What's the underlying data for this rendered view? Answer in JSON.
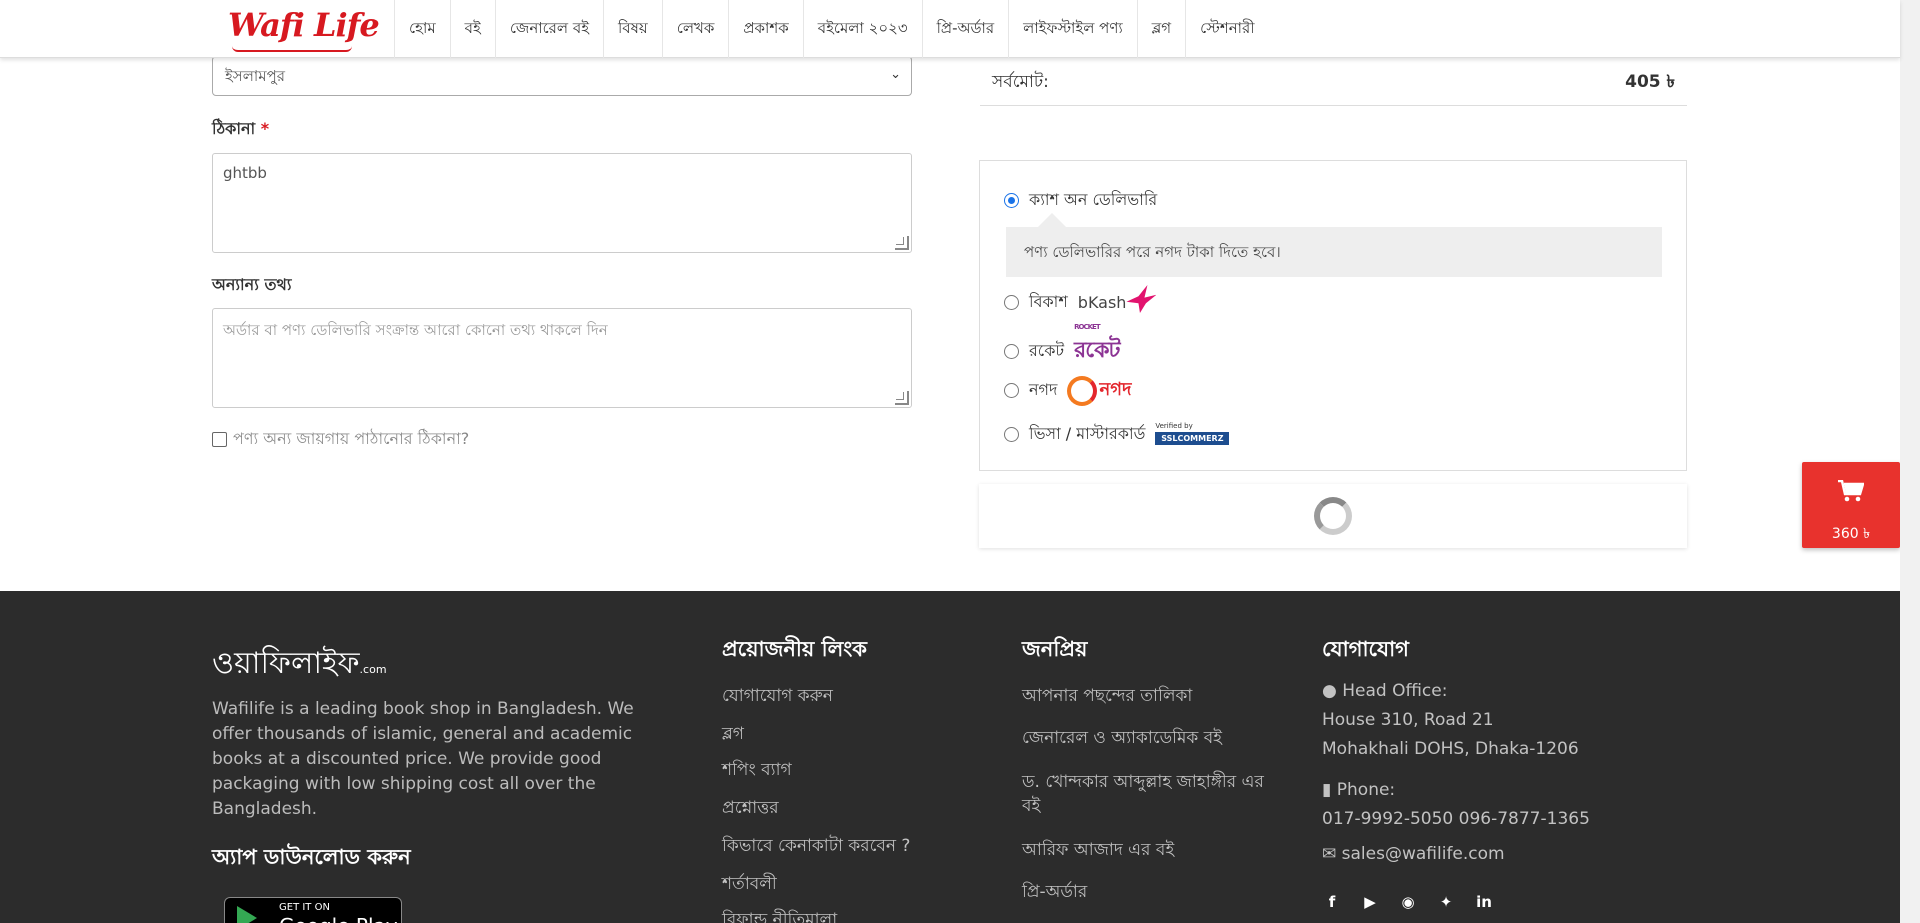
{
  "header": {
    "logo": "Wafi Life",
    "nav": [
      "হোম",
      "বই",
      "জেনারেল বই",
      "বিষয়",
      "লেখক",
      "প্রকাশক",
      "বইমেলা ২০২৩",
      "প্রি-অর্ডার",
      "লাইফস্টাইল পণ্য",
      "ব্লগ",
      "স্টেশনারী"
    ]
  },
  "form": {
    "area_select_value": "ইসলামপুর",
    "address_label": "ঠিকানা",
    "address_required": "*",
    "address_value": "ghtbb",
    "other_info_label": "অন্যান্য তথ্য",
    "other_info_placeholder": "অর্ডার বা পণ্য ডেলিভারি সংক্রান্ত আরো কোনো তথ্য থাকলে দিন",
    "ship_elsewhere_label": "পণ্য অন্য জায়গায় পাঠানোর ঠিকানা?"
  },
  "summary": {
    "total_label": "সর্বমোট:",
    "total_value": "405 ৳"
  },
  "payment": {
    "cod_label": "ক্যাশ অন ডেলিভারি",
    "cod_note": "পণ্য ডেলিভারির পরে নগদ টাকা দিতে হবে।",
    "bkash_label": "বিকাশ",
    "bkash_logo": "bKash",
    "rocket_label": "রকেট",
    "rocket_logo_small": "ROCKET",
    "rocket_logo": "রকেট",
    "nagad_label": "নগদ",
    "nagad_logo": "নগদ",
    "card_label": "ভিসা / মাস্টারকার্ড",
    "ssl_small": "Verified by",
    "ssl_logo": "SSLCOMMERZ",
    "selected": "cod"
  },
  "cart": {
    "total": "360 ৳"
  },
  "footer": {
    "logo": "ওয়াফিলাইফ",
    "logo_suffix": ".com",
    "about": "Wafilife is a leading book shop in Bangladesh. We offer thousands of islamic, general and academic books at a discounted price. We provide good packaging with low shipping cost all over the Bangladesh.",
    "app_heading": "অ্যাপ ডাউনলোড করুন",
    "gplay_small": "GET IT ON",
    "gplay_big": "Google Play",
    "links_heading": "প্রয়োজনীয় লিংক",
    "links": [
      "যোগাযোগ করুন",
      "ব্লগ",
      "শপিং ব্যাগ",
      "প্রশ্নোত্তর",
      "কিভাবে কেনাকাটা করবেন ?",
      "শর্তাবলী",
      "রিফান্ড নীতিমালা"
    ],
    "popular_heading": "জনপ্রিয়",
    "popular": [
      "আপনার পছন্দের তালিকা",
      "জেনারেল ও অ্যাকাডেমিক বই",
      "ড. খোন্দকার আব্দুল্লাহ জাহাঙ্গীর এর",
      "বই",
      "আরিফ আজাদ এর বই",
      "প্রি-অর্ডার"
    ],
    "contact_heading": "যোগাযোগ",
    "office_label": "Head Office:",
    "address_line1": "House 310, Road 21",
    "address_line2": "Mohakhali DOHS, Dhaka-1206",
    "phone_label": "Phone:",
    "phones": "017-9992-5050  096-7877-1365",
    "email": "sales@wafilife.com",
    "social_icons": [
      "facebook-icon",
      "youtube-icon",
      "instagram-icon",
      "twitter-icon",
      "linkedin-icon"
    ]
  },
  "colors": {
    "brand_red": "#d71920",
    "footer_bg": "#2c2c2c",
    "radio_blue": "#1a73e8",
    "cart_red": "#e8322d"
  }
}
